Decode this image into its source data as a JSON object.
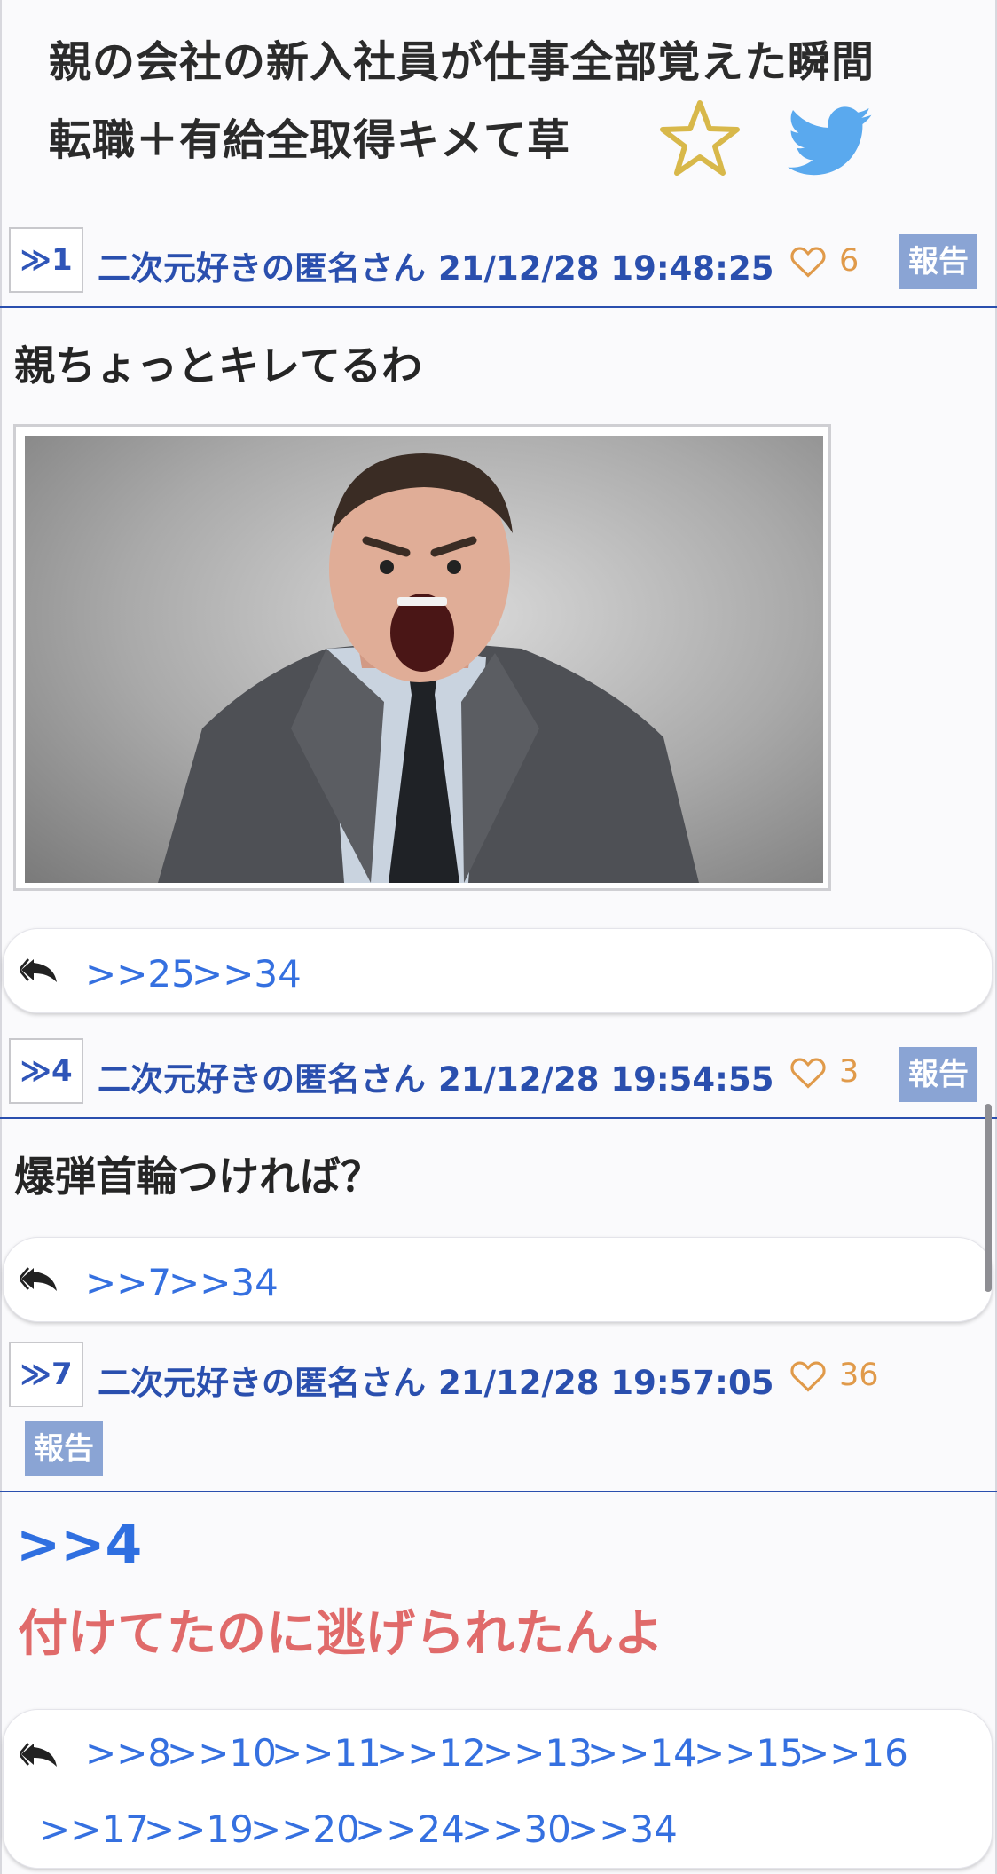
{
  "thread": {
    "title_line1": "親の会社の新入社員が仕事全部覚えた瞬間",
    "title_line2": "転職＋有給全取得キメて草",
    "favorite_icon": "star-outline-icon",
    "share_icon": "twitter-bird-icon",
    "colors": {
      "star": "#d8b84a",
      "twitter": "#5aa9ee",
      "accent": "#2a4fae",
      "link": "#3570e0",
      "emphasis": "#e06a6a"
    }
  },
  "posts": [
    {
      "number": "≫1",
      "name": "二次元好きの匿名さん",
      "datetime": "21/12/28 19:48:25",
      "likes": "6",
      "report_label": "報告",
      "body": "親ちょっとキレてるわ",
      "replies": [
        ">>25",
        ">>34"
      ]
    },
    {
      "number": "≫4",
      "name": "二次元好きの匿名さん",
      "datetime": "21/12/28 19:54:55",
      "likes": "3",
      "report_label": "報告",
      "body": "爆弾首輪つければ？",
      "replies": [
        ">>7",
        ">>34"
      ]
    },
    {
      "number": "≫7",
      "name": "二次元好きの匿名さん",
      "datetime": "21/12/28 19:57:05",
      "likes": "36",
      "report_label": "報告",
      "anchor": ">>4",
      "body": "付けてたのに逃げられたんよ",
      "replies": [
        ">>8",
        ">>10",
        ">>11",
        ">>12",
        ">>13",
        ">>14",
        ">>15",
        ">>16",
        ">>17",
        ">>19",
        ">>20",
        ">>24",
        ">>30",
        ">>34"
      ]
    }
  ]
}
